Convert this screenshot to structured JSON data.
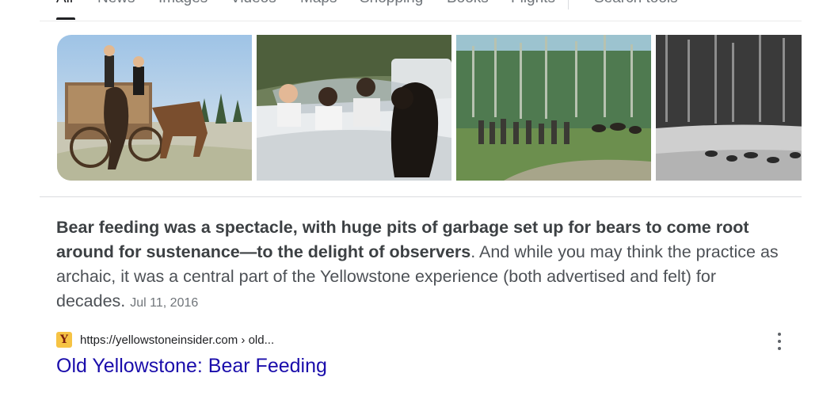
{
  "tabs": [
    {
      "label": "All"
    },
    {
      "label": "News"
    },
    {
      "label": "Images"
    },
    {
      "label": "Videos"
    },
    {
      "label": "Maps"
    },
    {
      "label": "Shopping"
    },
    {
      "label": "Books"
    },
    {
      "label": "Flights"
    }
  ],
  "search_tools_label": "Search tools",
  "images": [
    {
      "name": "bear-wagon-photo",
      "alt": "bear at wagon"
    },
    {
      "name": "bear-car-photo",
      "alt": "bear at car"
    },
    {
      "name": "bear-crowd-photo",
      "alt": "crowd watching bears"
    },
    {
      "name": "bear-pit-photo",
      "alt": "bears at feeding pit"
    }
  ],
  "snippet": {
    "bold": "Bear feeding was a spectacle, with huge pits of garbage set up for bears to come root around for sustenance—to the delight of observers",
    "rest": ". And while you may think the practice as archaic, it was a central part of the Yellowstone experience (both advertised and felt) for decades.",
    "date": "Jul 11, 2016"
  },
  "source": {
    "favicon_letter": "Y",
    "url": "https://yellowstoneinsider.com › old..."
  },
  "result": {
    "title": "Old Yellowstone: Bear Feeding"
  },
  "colors": {
    "link": "#1a0dab",
    "snippet_text": "#4d5156",
    "muted": "#70757a",
    "favicon_bg": "#f6c344"
  }
}
